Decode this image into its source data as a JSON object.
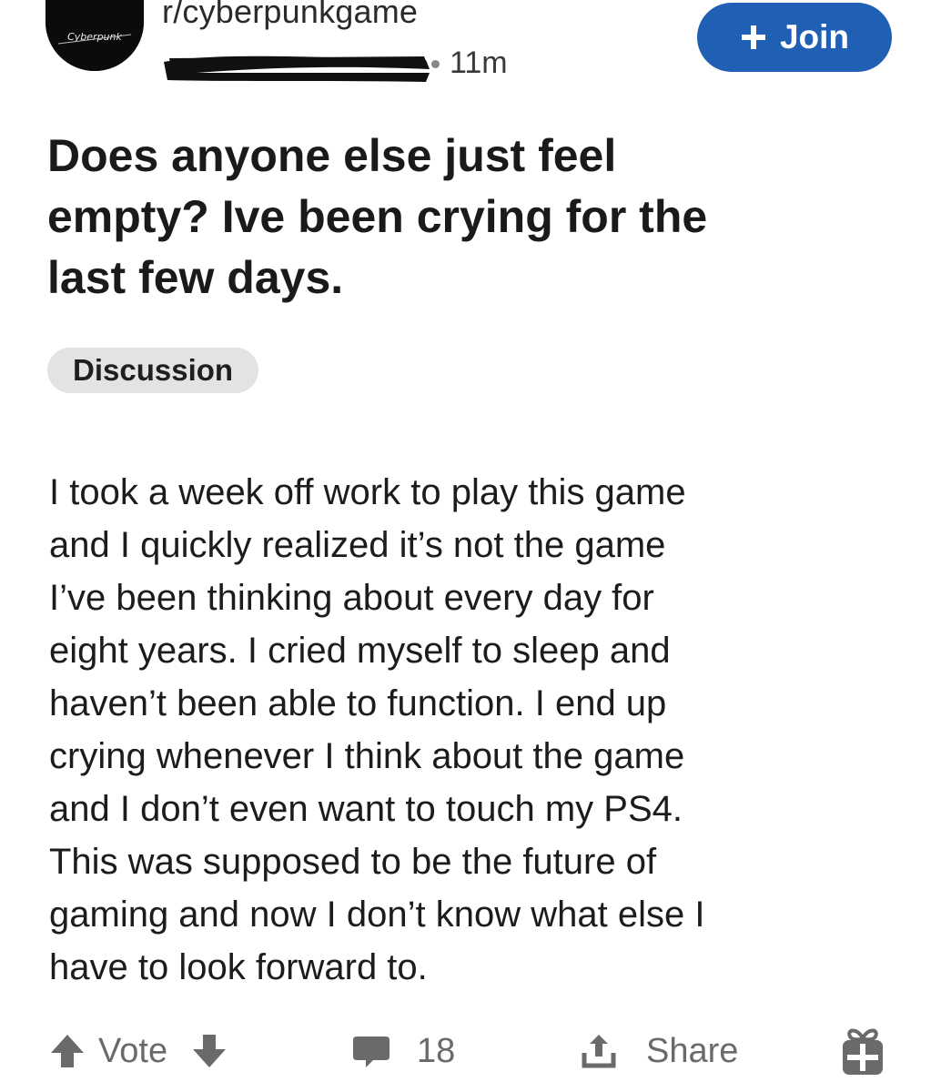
{
  "post": {
    "subreddit": "r/cyberpunkgame",
    "time": "11m",
    "avatar_logo_text": "Cyberpunk",
    "join_label": "Join",
    "title": "Does anyone else just feel empty? Ive been crying for the last few days.",
    "title_lines": [
      "Does anyone else just feel",
      "empty? Ive been crying for the",
      "last few days."
    ],
    "flair": "Discussion",
    "body_lines": [
      "I took a week off work to play this game",
      "and I quickly realized it’s not the game",
      "I’ve been thinking about every day for",
      "eight years. I cried myself to sleep and",
      "haven’t been able to function. I end up",
      "crying whenever I think about the game",
      "and I don’t even want to touch my PS4.",
      "This was supposed to be the future of",
      "gaming and now I don’t know what else I",
      "have to look forward to."
    ]
  },
  "actions": {
    "vote_label": "Vote",
    "comment_count": "18",
    "share_label": "Share"
  },
  "icons": {
    "upvote": "arrow-up-icon",
    "downvote": "arrow-down-icon",
    "comment": "comment-bubble-icon",
    "share": "share-icon",
    "award": "gift-award-icon",
    "join_plus": "plus-icon"
  },
  "colors": {
    "join_button": "#1f5fb4",
    "flair_bg": "#e3e3e3",
    "action_gray": "#6a6a6a",
    "text": "#1c1c1c"
  }
}
